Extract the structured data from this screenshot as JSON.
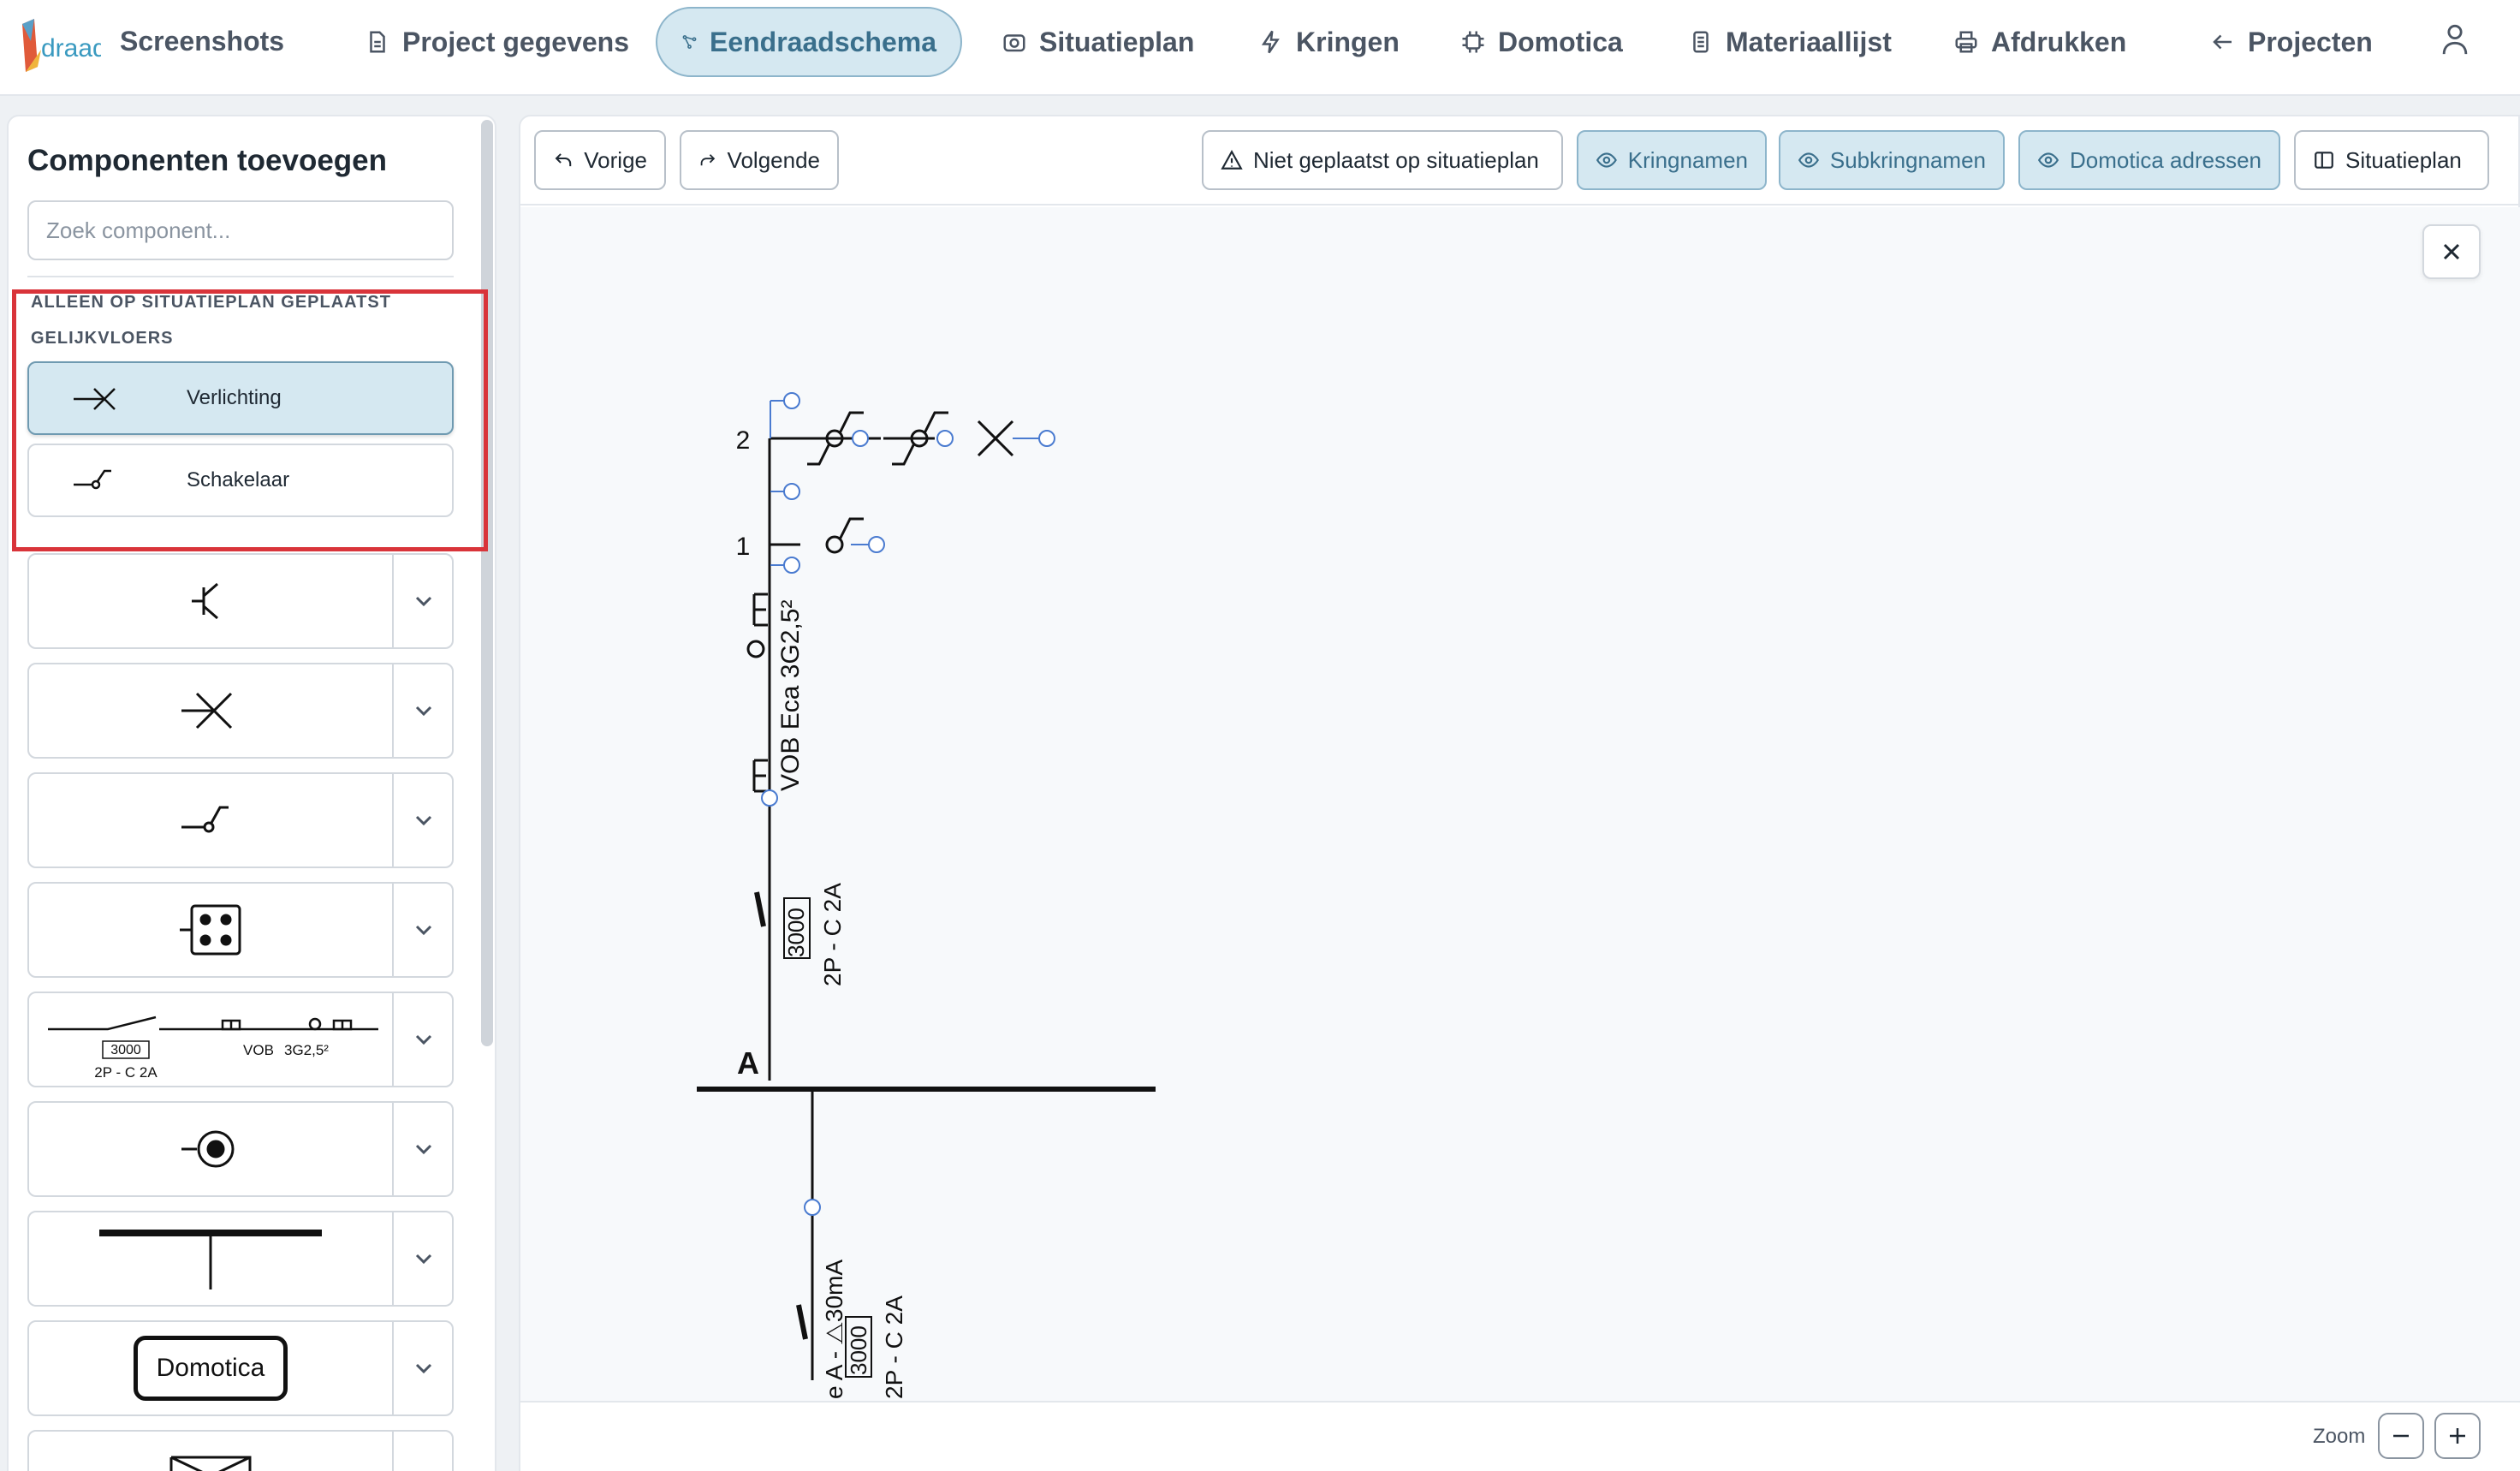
{
  "nav": {
    "brand": "Screenshots",
    "items": [
      {
        "label": "Project gegevens",
        "icon": "document-icon"
      },
      {
        "label": "Eendraadschema",
        "icon": "schema-icon",
        "active": true
      },
      {
        "label": "Situatieplan",
        "icon": "camera-icon"
      },
      {
        "label": "Kringen",
        "icon": "lightning-icon"
      },
      {
        "label": "Domotica",
        "icon": "chip-icon"
      },
      {
        "label": "Materiaallijst",
        "icon": "list-icon"
      },
      {
        "label": "Afdrukken",
        "icon": "printer-icon"
      },
      {
        "label": "Projecten",
        "icon": "arrow-left-icon"
      }
    ]
  },
  "sidebar": {
    "title": "Componenten toevoegen",
    "search_placeholder": "Zoek component...",
    "section_heading": "ALLEEN OP SITUATIEPLAN GEPLAATST",
    "subsection_heading": "GELIJKVLOERS",
    "placed_items": [
      {
        "label": "Verlichting",
        "icon": "light-icon",
        "selected": true
      },
      {
        "label": "Schakelaar",
        "icon": "switch-icon",
        "selected": false
      }
    ],
    "symbol_rows": [
      {
        "icon": "transistor-symbol-icon"
      },
      {
        "icon": "light-symbol-icon"
      },
      {
        "icon": "switch-symbol-icon"
      },
      {
        "icon": "socket-symbol-icon"
      },
      {
        "icon": "circuit-line-symbol-icon",
        "texts": [
          "3000",
          "2P - C 2A",
          "VOB",
          "3G2,5²"
        ]
      },
      {
        "icon": "outlet-point-symbol-icon"
      },
      {
        "icon": "busbar-symbol-icon"
      },
      {
        "icon": "domotica-symbol-icon",
        "text": "Domotica"
      },
      {
        "icon": "box-symbol-icon"
      }
    ]
  },
  "toolbar": {
    "prev": "Vorige",
    "next": "Volgende",
    "not_placed": "Niet geplaatst op situatieplan",
    "kringnamen": "Kringnamen",
    "subkringnamen": "Subkringnamen",
    "domotica_adressen": "Domotica adressen",
    "situatieplan": "Situatieplan"
  },
  "schema": {
    "row2": "2",
    "row1": "1",
    "cable": "VOB Eca 3G2,5²",
    "breaker_rating": "3000",
    "breaker_spec": "2P - C 2A",
    "bus_label": "A",
    "rcd_text": "e A - ⧍30mA",
    "rcd_rating": "3000",
    "rcd_spec": "2P - C 2A"
  },
  "zoom": {
    "label": "Zoom"
  }
}
